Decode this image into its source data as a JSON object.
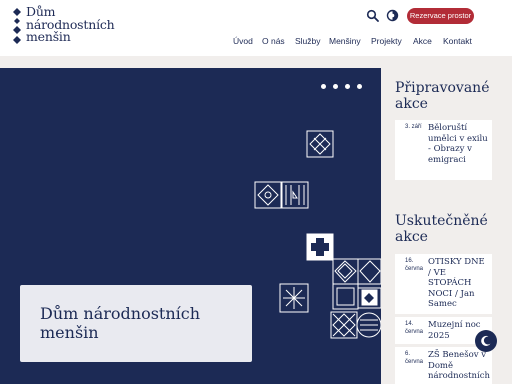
{
  "header": {
    "logo_line1": "Dům",
    "logo_line2": "národnostních",
    "logo_line3": "menšin",
    "search_icon": "search-icon",
    "language_icon": "globe-icon",
    "reserve_label": "Rezervace prostor",
    "accent_color": "#b22c37",
    "brand_color": "#1c2a55"
  },
  "nav": {
    "items": [
      "Úvod",
      "O nás",
      "Služby",
      "Menšiny",
      "Projekty",
      "Akce",
      "Kontakt"
    ]
  },
  "hero": {
    "title": "Dům národnostních menšin",
    "slides": 4
  },
  "upcoming": {
    "title": "Připravované akce",
    "events": [
      {
        "date": "3. září",
        "title": "Běloruští umělci v exilu - Obrazy v emigraci"
      }
    ]
  },
  "past": {
    "title": "Uskutečněné akce",
    "events": [
      {
        "date": "16. června",
        "title": "OTISKY DNE / VE STOPÁCH NOCI / Jan Samec"
      },
      {
        "date": "14. června",
        "title": "Muzejní noc 2025"
      },
      {
        "date": "6. června",
        "title": "ZŠ Benešov v Domě národnostních"
      }
    ]
  },
  "dark_mode_icon": "moon-icon"
}
